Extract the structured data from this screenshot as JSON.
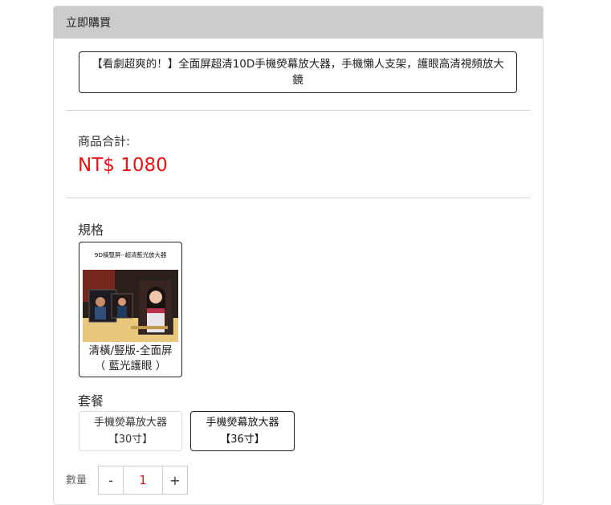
{
  "panel": {
    "header_title": "立即購買"
  },
  "product": {
    "title": "【看劇超爽的！】全面屏超清10D手機熒幕放大器，手機懶人支架，護眼高清視頻放大鏡"
  },
  "total": {
    "label": "商品合計:",
    "price": "NT$ 1080"
  },
  "spec": {
    "label": "規格",
    "options": [
      {
        "image_caption": "9D橫豎屏--超清藍光放大器",
        "line1": "清橫/豎版-全面屏",
        "line2": "（ 藍光護眼 ）"
      }
    ]
  },
  "package": {
    "label": "套餐",
    "options": [
      {
        "line1": "手機熒幕放大器",
        "line2": "【30寸】"
      },
      {
        "line1": "手機熒幕放大器",
        "line2": "【36寸】"
      }
    ]
  },
  "quantity": {
    "label": "數量",
    "minus": "-",
    "value": "1",
    "plus": "+"
  },
  "colors": {
    "price": "#ee1111",
    "header_bg": "#cccccc",
    "selected_border": "#222222"
  }
}
